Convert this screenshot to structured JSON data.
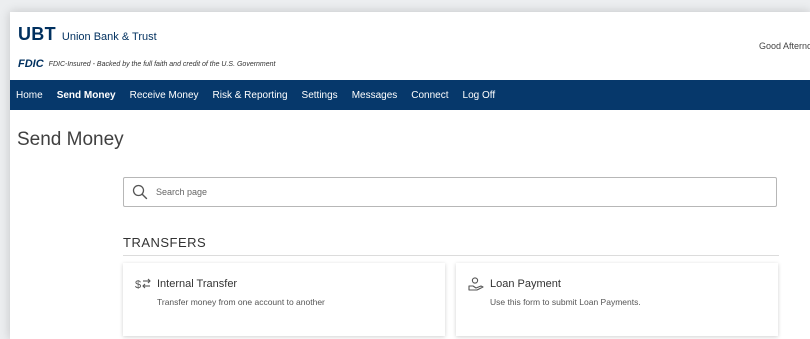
{
  "header": {
    "logo_mark": "UBT",
    "logo_name": "Union Bank & Trust",
    "fdic_mark": "FDIC",
    "fdic_text": "FDIC-Insured - Backed by the full faith and credit of the U.S. Government",
    "greeting": "Good Afterno"
  },
  "nav": {
    "items": [
      {
        "label": "Home"
      },
      {
        "label": "Send Money"
      },
      {
        "label": "Receive Money"
      },
      {
        "label": "Risk & Reporting"
      },
      {
        "label": "Settings"
      },
      {
        "label": "Messages"
      },
      {
        "label": "Connect"
      },
      {
        "label": "Log Off"
      }
    ],
    "active": "Send Money"
  },
  "page": {
    "title": "Send Money"
  },
  "search": {
    "placeholder": "Search page",
    "value": ""
  },
  "section": {
    "heading": "TRANSFERS"
  },
  "cards": [
    {
      "title": "Internal Transfer",
      "description": "Transfer money from one account to another",
      "icon": "transfer-dollar-icon"
    },
    {
      "title": "Loan Payment",
      "description": "Use this form to submit Loan Payments.",
      "icon": "loan-payment-icon"
    }
  ],
  "colors": {
    "brand_navy": "#06386b",
    "logo_navy": "#00305f"
  }
}
